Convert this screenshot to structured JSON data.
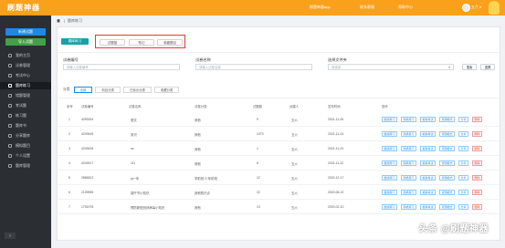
{
  "app": {
    "logo": "刷题神器"
  },
  "sidebar": {
    "primary_button": "新建试题",
    "secondary_button": "导入试题",
    "items": [
      {
        "label": "我的主页"
      },
      {
        "label": "试卷管理"
      },
      {
        "label": "考试中心"
      },
      {
        "label": "题库练习"
      },
      {
        "label": "错题管理"
      },
      {
        "label": "考试题"
      },
      {
        "label": "练习题"
      },
      {
        "label": "题库书"
      },
      {
        "label": "分享题库"
      },
      {
        "label": "模拟题目"
      },
      {
        "label": "个人设置"
      },
      {
        "label": "题库管理"
      }
    ],
    "active_index": 3,
    "collapse_label": "≡"
  },
  "header": {
    "links": [
      "刷题神器app",
      "联系客服",
      "帮助中心"
    ],
    "user_name": "五六 ▾"
  },
  "breadcrumb": {
    "current": "题库练习"
  },
  "tabs": {
    "active": "题库练习",
    "others": [
      "试题篮",
      "笔记",
      "收藏题目"
    ]
  },
  "filters": {
    "id_label": "试卷编号",
    "id_placeholder": "请输入试卷编号",
    "name_label": "试卷名称",
    "name_placeholder": "请输入试卷名称",
    "folder_label": "选择文件夹",
    "folder_placeholder": "请选择",
    "search_button": "搜索",
    "reset_button": "重置"
  },
  "categories": {
    "label": "分类",
    "items": [
      "全部",
      "科目分类",
      "已标示分类",
      "收藏分类"
    ],
    "active_index": 0
  },
  "table": {
    "headers": [
      "序号",
      "试卷编号",
      "试卷名称",
      "试卷分类",
      "试题数",
      "创建人",
      "发布时间",
      "操作"
    ],
    "rows": [
      [
        "1",
        "4293254",
        "语文",
        "其他",
        "9",
        "五六",
        "2021-11-25"
      ],
      [
        "2",
        "4249449",
        "常识",
        "其他",
        "1373",
        "五六",
        "2021-11-24"
      ],
      [
        "3",
        "4249426",
        "ss",
        "其他",
        "1",
        "五六",
        "2021-11-24"
      ],
      [
        "4",
        "4243917",
        "111",
        "其他",
        "6",
        "五六",
        "2021-11-22"
      ],
      [
        "5",
        "2856812",
        "qi一年",
        "学前班-少年阶段",
        "12",
        "五六",
        "2020-12-17"
      ],
      [
        "6",
        "2139955",
        "端午节小知识",
        "其他知识点",
        "22",
        "五六",
        "2020-06-22"
      ],
      [
        "7",
        "1751978",
        "预防新型冠状病毒小知识",
        "其他",
        "13",
        "五六",
        "2020-02-10"
      ]
    ],
    "actions": [
      "继续练习",
      "随机练习",
      "模拟考试",
      "背题模式",
      "分享",
      "删除"
    ]
  },
  "watermark": "头条 @刷题神器"
}
